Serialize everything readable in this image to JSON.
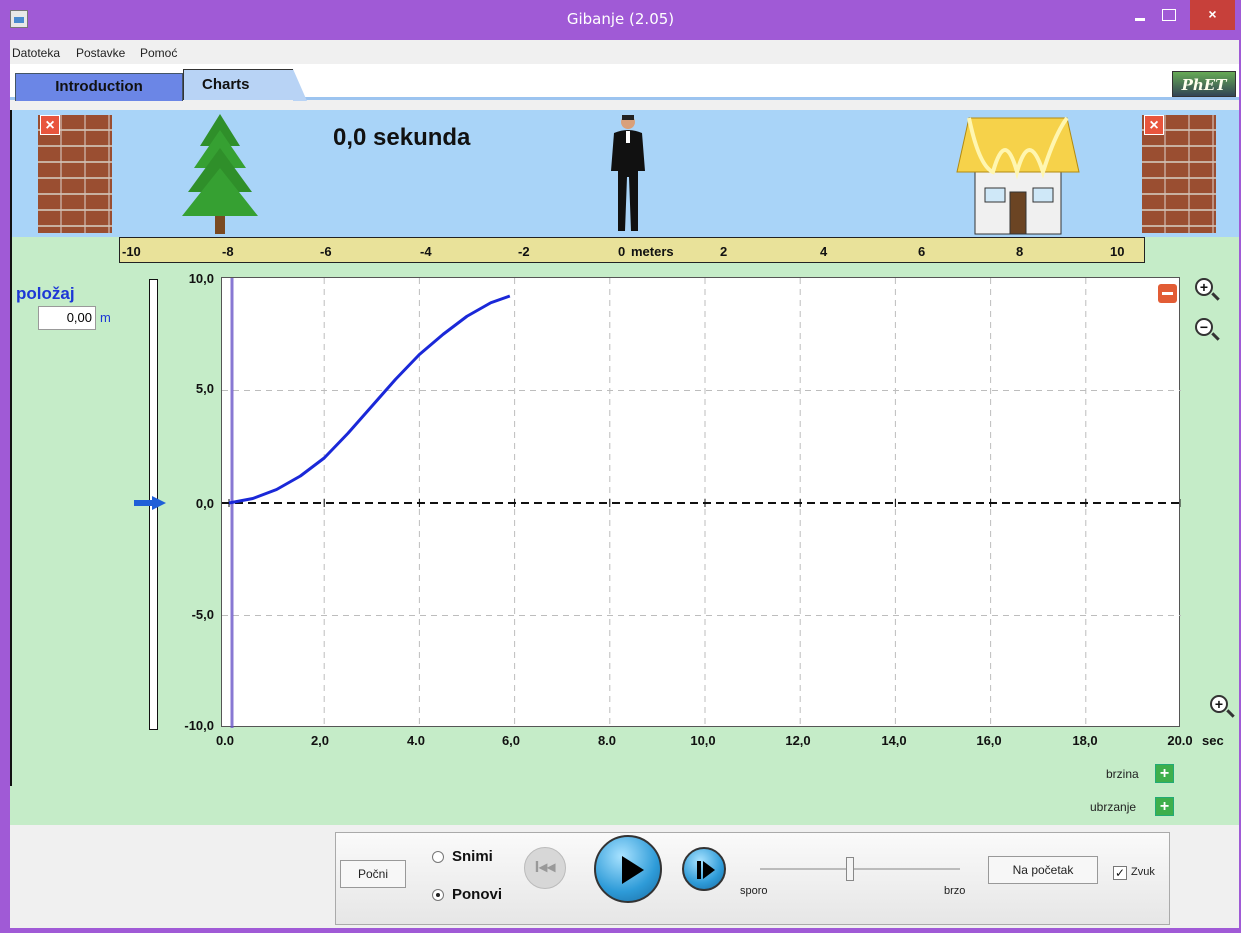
{
  "window": {
    "title": "Gibanje (2.05)",
    "close_glyph": "×"
  },
  "menu": {
    "items": [
      "Datoteka",
      "Postavke",
      "Pomoć"
    ]
  },
  "tabs": [
    {
      "label": "Introduction"
    },
    {
      "label": "Charts"
    }
  ],
  "logo": {
    "text": "PhET"
  },
  "scene": {
    "time_label": "0,0 sekunda",
    "ruler_ticks": [
      "-10",
      "-8",
      "-6",
      "-4",
      "-2",
      "0",
      "2",
      "4",
      "6",
      "8",
      "10"
    ],
    "ruler_unit": "meters",
    "remove_wall_glyph": "×"
  },
  "position": {
    "label": "položaj",
    "value": "0,00",
    "unit": "m",
    "slider_value": 0.0
  },
  "chart_data": {
    "type": "line",
    "y_ticks": [
      "10,0",
      "5,0",
      "0,0",
      "-5,0",
      "-10,0"
    ],
    "x_ticks": [
      "0.0",
      "2,0",
      "4.0",
      "6,0",
      "8.0",
      "10,0",
      "12,0",
      "14,0",
      "16,0",
      "18,0",
      "20.0"
    ],
    "x_unit": "sec",
    "ylim": [
      -10,
      10
    ],
    "xlim": [
      0,
      20
    ],
    "grid": true,
    "series": [
      {
        "color": "#1a28d8",
        "x": [
          0.0,
          0.5,
          1.0,
          1.5,
          2.0,
          2.5,
          3.0,
          3.5,
          4.0,
          4.5,
          5.0,
          5.5,
          5.9
        ],
        "y": [
          0.0,
          0.2,
          0.6,
          1.2,
          2.0,
          3.1,
          4.3,
          5.5,
          6.6,
          7.5,
          8.3,
          8.9,
          9.2
        ]
      }
    ],
    "current_time": 0.0
  },
  "series_controls": [
    {
      "label": "brzina",
      "glyph": "+"
    },
    {
      "label": "ubrzanje",
      "glyph": "+"
    }
  ],
  "zoom": {
    "in_glyph": "+",
    "out_glyph": "−"
  },
  "controls": {
    "start_button": "Počni",
    "record_label": "Snimi",
    "playback_label": "Ponovi",
    "playback_selected": true,
    "rewind_glyph": "I◂◂",
    "slow_label": "sporo",
    "fast_label": "brzo",
    "speed_value": 0.45,
    "reset_button": "Na početak",
    "sound_label": "Zvuk",
    "sound_checked": true,
    "check_glyph": "✓"
  },
  "colors": {
    "accent": "#1d37d6",
    "sky": "#a9d4f8",
    "ground": "#c5ecc8",
    "title_bar": "#a05ad6"
  }
}
